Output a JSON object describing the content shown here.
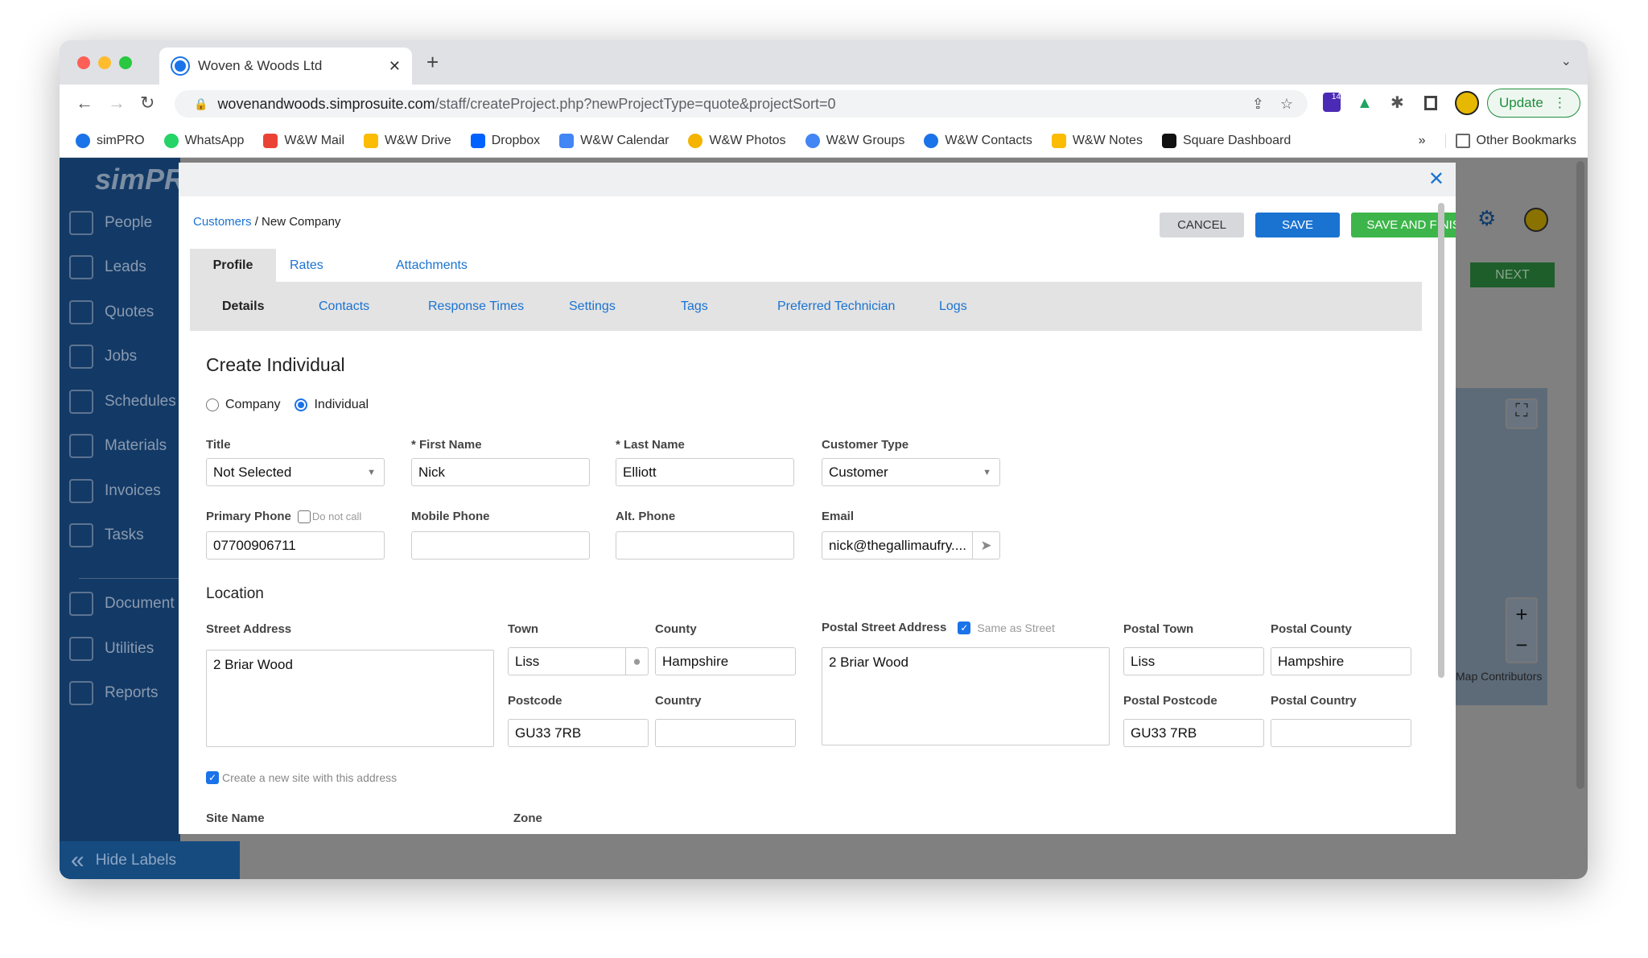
{
  "browser": {
    "tab_title": "Woven & Woods Ltd",
    "url_host": "wovenandwoods.simprosuite.com",
    "url_path": "/staff/createProject.php?newProjectType=quote&projectSort=0",
    "update_label": "Update",
    "ext_badge": "14",
    "bookmarks": [
      "simPRO",
      "WhatsApp",
      "W&W Mail",
      "W&W Drive",
      "Dropbox",
      "W&W Calendar",
      "W&W Photos",
      "W&W Groups",
      "W&W Contacts",
      "W&W Notes",
      "Square Dashboard"
    ],
    "other_bookmarks": "Other Bookmarks",
    "more": "»"
  },
  "app": {
    "logo": "simPRO",
    "sidebar": [
      "People",
      "Leads",
      "Quotes",
      "Jobs",
      "Schedules",
      "Materials",
      "Invoices",
      "Tasks",
      "Document",
      "Utilities",
      "Reports"
    ],
    "hide_labels": "Hide Labels",
    "next_label": "NEXT",
    "map_attribution": "Map Contributors"
  },
  "modal": {
    "breadcrumb_link": "Customers",
    "breadcrumb_current": " / New Company",
    "cancel": "CANCEL",
    "save": "SAVE",
    "save_finish": "SAVE AND FINISH",
    "tabs": [
      "Profile",
      "Rates",
      "Attachments"
    ],
    "subtabs": [
      "Details",
      "Contacts",
      "Response Times",
      "Settings",
      "Tags",
      "Preferred Technician",
      "Logs"
    ],
    "heading": "Create Individual",
    "radio_company": "Company",
    "radio_individual": "Individual",
    "fields": {
      "title_label": "Title",
      "title_value": "Not Selected",
      "first_label": "* First Name",
      "first_value": "Nick",
      "last_label": "* Last Name",
      "last_value": "Elliott",
      "ctype_label": "Customer Type",
      "ctype_value": "Customer",
      "phone_label": "Primary Phone",
      "do_not_call": "Do not call",
      "phone_value": "07700906711",
      "mobile_label": "Mobile Phone",
      "mobile_value": "",
      "alt_label": "Alt. Phone",
      "alt_value": "",
      "email_label": "Email",
      "email_value": "nick@thegallimaufry...."
    },
    "location": {
      "heading": "Location",
      "street_label": "Street Address",
      "street_value": "2 Briar Wood",
      "town_label": "Town",
      "town_value": "Liss",
      "county_label": "County",
      "county_value": "Hampshire",
      "postcode_label": "Postcode",
      "postcode_value": "GU33 7RB",
      "country_label": "Country",
      "country_value": "",
      "pstreet_label": "Postal Street Address",
      "same_as_street": "Same as Street",
      "pstreet_value": "2 Briar Wood",
      "ptown_label": "Postal Town",
      "ptown_value": "Liss",
      "pcounty_label": "Postal County",
      "pcounty_value": "Hampshire",
      "ppostcode_label": "Postal Postcode",
      "ppostcode_value": "GU33 7RB",
      "pcountry_label": "Postal Country",
      "pcountry_value": "",
      "new_site": "Create a new site with this address",
      "site_name_label": "Site Name",
      "zone_label": "Zone"
    }
  },
  "colors": {
    "sidebar": "#133a66",
    "save": "#1a73d1",
    "save_finish": "#3db54a",
    "link": "#1a73d1"
  }
}
